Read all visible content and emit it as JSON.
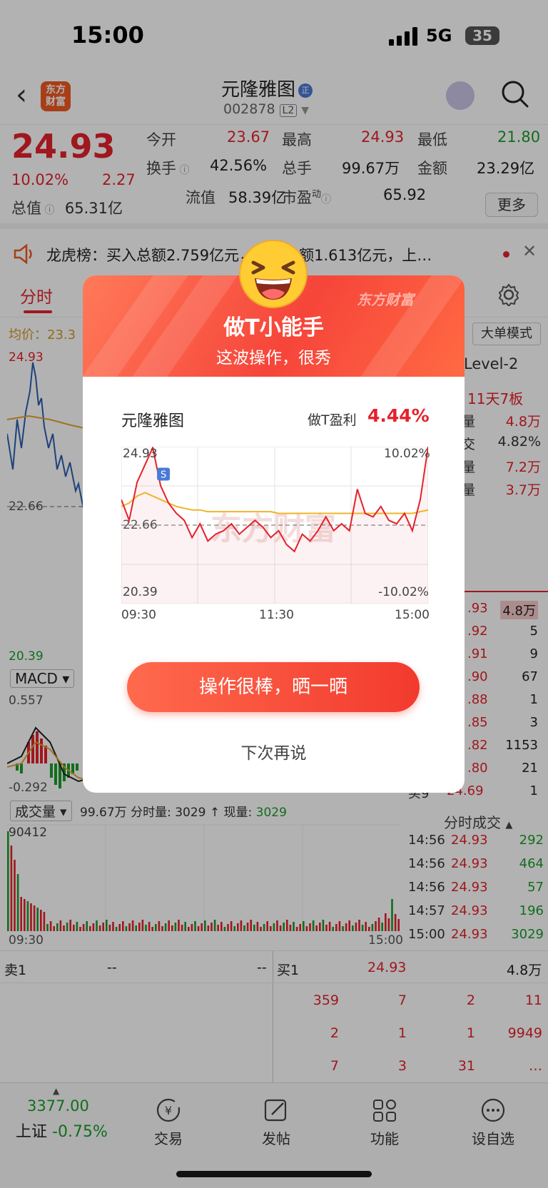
{
  "status_bar": {
    "time": "15:00",
    "network": "5G",
    "battery": "35"
  },
  "nav": {
    "logo_text_line1": "东方",
    "logo_text_line2": "财富",
    "stock_name": "元隆雅图",
    "stock_name_badge": "正",
    "stock_code": "002878",
    "level_badge": "L2"
  },
  "quote": {
    "price": "24.93",
    "change_pct": "10.02%",
    "change_amt": "2.27",
    "total_value_label": "总值",
    "total_value": "65.31亿",
    "open_label": "今开",
    "open": "23.67",
    "high_label": "最高",
    "high": "24.93",
    "low_label": "最低",
    "low": "21.80",
    "turnover_label": "换手",
    "turnover": "42.56%",
    "volume_label": "总手",
    "volume": "99.67万",
    "amount_label": "金额",
    "amount": "23.29亿",
    "float_label": "流值",
    "float_value": "58.39亿",
    "pe_label": "市盈",
    "pe_sup": "动",
    "pe": "65.92",
    "more_label": "更多"
  },
  "ticker": {
    "text": "龙虎榜：买入总额2.759亿元，卖出总额1.613亿元，上…"
  },
  "tabs": {
    "active": "分时"
  },
  "chart_bg": {
    "avg_label": "均价：23.3",
    "big_order_mode": "大单模式",
    "level2": "Level-2",
    "streak": "11天7板",
    "high_label": "24.93",
    "prev_close": "22.66",
    "low_label": "20.39",
    "macd_label": "MACD",
    "macd_top": "0.557",
    "macd_bottom": "-0.292",
    "vol_label": "成交量",
    "vol_info": "99.67万 分时量: 3029 ↑ 现量:",
    "vol_now": "3029",
    "vol_max": "90412",
    "t_start": "09:30",
    "t_end": "15:00"
  },
  "side_stats": [
    {
      "label": "单量",
      "value": "4.8万",
      "color": "#e5212b"
    },
    {
      "label": "成交",
      "value": "4.82%",
      "color": "#333333"
    },
    {
      "label": "单量",
      "value": "7.2万",
      "color": "#e5212b"
    },
    {
      "label": "交量",
      "value": "3.7万",
      "color": "#e5212b"
    }
  ],
  "buy_book": [
    {
      "price": ".93",
      "qty": "4.8万"
    },
    {
      "price": ".92",
      "qty": "5"
    },
    {
      "price": ".91",
      "qty": "9"
    },
    {
      "price": ".90",
      "qty": "67"
    },
    {
      "price": ".88",
      "qty": "1"
    },
    {
      "price": ".85",
      "qty": "3"
    },
    {
      "price": ".82",
      "qty": "1153"
    },
    {
      "price": ".80",
      "qty": "21"
    },
    {
      "label": "买9",
      "price": "24.69",
      "qty": "1"
    }
  ],
  "ticks": {
    "title": "分时成交",
    "rows": [
      {
        "time": "14:56",
        "price": "24.93",
        "qty": "292"
      },
      {
        "time": "14:56",
        "price": "24.93",
        "qty": "464"
      },
      {
        "time": "14:56",
        "price": "24.93",
        "qty": "57"
      },
      {
        "time": "14:57",
        "price": "24.93",
        "qty": "196"
      },
      {
        "time": "15:00",
        "price": "24.93",
        "qty": "3029"
      }
    ]
  },
  "bottom_book": {
    "sell1_label": "卖1",
    "sell1_price": "--",
    "sell1_qty": "--",
    "buy1_label": "买1",
    "buy1_price": "24.93",
    "buy1_qty": "4.8万",
    "rows": [
      [
        "359",
        "7",
        "2",
        "11"
      ],
      [
        "2",
        "1",
        "1",
        "9949"
      ],
      [
        "7",
        "3",
        "31",
        "…"
      ]
    ]
  },
  "bottom_nav": {
    "index_value": "3377.00",
    "index_name": "上证",
    "index_change": "-0.75%",
    "items": [
      "交易",
      "发帖",
      "功能",
      "设自选"
    ]
  },
  "modal": {
    "brand": "东方财富",
    "title": "做T小能手",
    "subtitle": "这波操作，很秀",
    "stock_name": "元隆雅图",
    "profit_label": "做T盈利",
    "profit_value": "4.44%",
    "share_button": "操作很棒，晒一晒",
    "later_button": "下次再说",
    "chart": {
      "y_high": "24.93",
      "y_mid": "22.66",
      "y_low": "20.39",
      "pct_high": "10.02%",
      "pct_low": "-10.02%",
      "x_labels": [
        "09:30",
        "11:30",
        "15:00"
      ],
      "buy_marker": "S"
    }
  },
  "chart_data": {
    "type": "line",
    "title": "",
    "xlabel": "",
    "ylabel": "",
    "x": [
      "09:30",
      "11:30",
      "15:00"
    ],
    "ylim": [
      20.39,
      24.93
    ],
    "series": [
      {
        "values": [
          23.4,
          22.8,
          23.9,
          24.4,
          24.9,
          23.8,
          23.3,
          23.0,
          22.8,
          22.3,
          22.7,
          22.2,
          22.4,
          22.5,
          22.7,
          22.4,
          22.6,
          22.8,
          22.6,
          22.3,
          22.5,
          22.1,
          21.9,
          22.4,
          22.2,
          22.5,
          22.9,
          22.5,
          22.7,
          22.5,
          23.7,
          23.0,
          22.9,
          23.2,
          22.8,
          22.7,
          23.0,
          22.5,
          23.4,
          24.93
        ]
      },
      {
        "values": [
          23.2,
          23.3,
          23.5,
          23.6,
          23.5,
          23.4,
          23.3,
          23.2,
          23.15,
          23.1,
          23.1,
          23.05,
          23.05,
          23.05,
          23.05,
          23.05,
          23.05,
          23.05,
          23.05,
          23.05,
          23.0,
          23.0,
          23.0,
          23.0,
          23.0,
          23.0,
          23.0,
          23.0,
          23.0,
          23.0,
          23.0,
          23.0,
          23.0,
          23.0,
          23.0,
          23.0,
          23.0,
          23.0,
          23.05,
          23.1
        ]
      }
    ],
    "reference_line": 22.66,
    "colors": {
      "price": "#e5212b",
      "average": "#f0b429",
      "prev_close": "#666666"
    }
  },
  "colors": {
    "up": "#e5212b",
    "down": "#1a9c2a",
    "brand": "#f05a23",
    "avg": "#d49a24"
  }
}
